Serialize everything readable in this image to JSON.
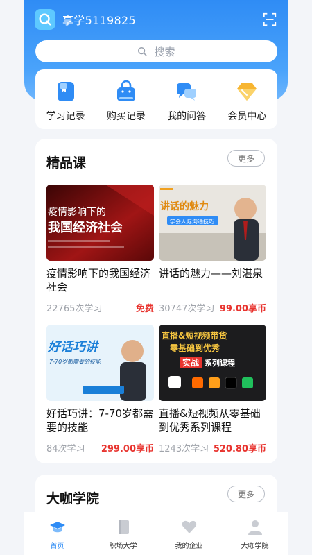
{
  "header": {
    "username": "享学5119825"
  },
  "search": {
    "placeholder": "搜索"
  },
  "quick_links": [
    {
      "label": "学习记录",
      "icon": "bookmark-icon"
    },
    {
      "label": "购买记录",
      "icon": "shopping-bag-icon"
    },
    {
      "label": "我的问答",
      "icon": "chat-bubbles-icon"
    },
    {
      "label": "会员中心",
      "icon": "diamond-icon"
    }
  ],
  "boutique": {
    "title": "精品课",
    "more_label": "更多",
    "courses": [
      {
        "title": "疫情影响下的我国经济社会",
        "count": "22765次学习",
        "price": "免费",
        "thumb_line1": "疫情影响下的",
        "thumb_line2": "我国经济社会"
      },
      {
        "title": "讲话的魅力——刘湛泉",
        "count": "30747次学习",
        "price": "99.00享币",
        "thumb_line1": "讲话的魅力",
        "thumb_line2": "学会人际沟通技巧"
      },
      {
        "title": "好话巧讲：7-70岁都需要的技能",
        "count": "84次学习",
        "price": "299.00享币",
        "thumb_line1": "好话巧讲",
        "thumb_line2": "7-70岁都需要的技能"
      },
      {
        "title": "直播&短视频从零基础到优秀系列课程",
        "count": "1243次学习",
        "price": "520.80享币",
        "thumb_line1": "直播&短视频带货",
        "thumb_line2": "零基础到优秀",
        "thumb_line3": "实战",
        "thumb_line4": "系列课程"
      }
    ]
  },
  "daka": {
    "title": "大咖学院",
    "more_label": "更多"
  },
  "tabbar": [
    {
      "label": "首页",
      "icon": "graduation-cap-icon",
      "active": true
    },
    {
      "label": "职场大学",
      "icon": "book-icon",
      "active": false
    },
    {
      "label": "我的企业",
      "icon": "heart-icon",
      "active": false
    },
    {
      "label": "大咖学院",
      "icon": "person-icon",
      "active": false
    }
  ],
  "colors": {
    "primary": "#2f8cf5",
    "price": "#e8342f",
    "background": "#f3f5f9"
  }
}
